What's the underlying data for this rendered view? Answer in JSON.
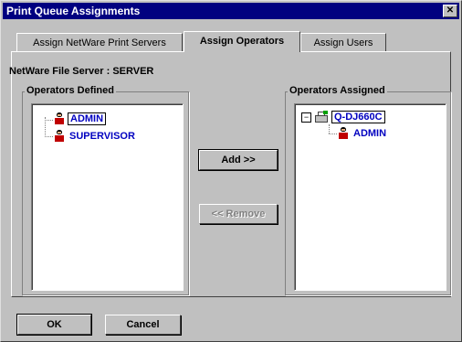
{
  "window": {
    "title": "Print Queue Assignments",
    "close_glyph": "✕"
  },
  "tabs": [
    {
      "label": "Assign NetWare Print Servers",
      "active": false
    },
    {
      "label": "Assign Operators",
      "active": true
    },
    {
      "label": "Assign Users",
      "active": false
    }
  ],
  "server": {
    "label": "NetWare File Server :",
    "value": "SERVER"
  },
  "operators_defined": {
    "label": "Operators Defined",
    "items": [
      {
        "name": "ADMIN",
        "icon": "user-icon",
        "selected": true
      },
      {
        "name": "SUPERVISOR",
        "icon": "user-icon",
        "selected": false
      }
    ]
  },
  "operators_assigned": {
    "label": "Operators Assigned",
    "queue": {
      "name": "Q-DJ660C",
      "icon": "print-queue-icon",
      "expanded": true,
      "expander_glyph": "−"
    },
    "items": [
      {
        "name": "ADMIN",
        "icon": "user-icon"
      }
    ]
  },
  "buttons": {
    "add": "Add >>",
    "remove": "<< Remove",
    "ok": "OK",
    "cancel": "Cancel"
  }
}
